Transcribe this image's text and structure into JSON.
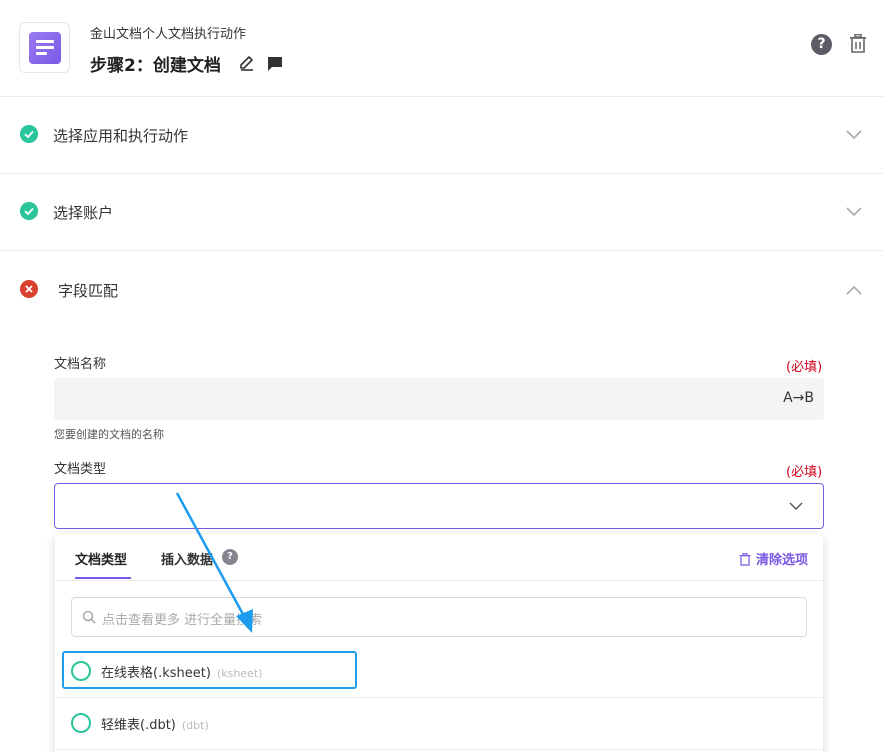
{
  "header": {
    "app_name": "金山文档个人文档执行动作",
    "step_title": "步骤2：创建文档"
  },
  "sections": [
    {
      "label": "选择应用和执行动作",
      "status": "ok"
    },
    {
      "label": "选择账户",
      "status": "ok"
    },
    {
      "label": "字段匹配",
      "status": "error"
    }
  ],
  "fields": {
    "doc_name": {
      "label": "文档名称",
      "required": "(必填)",
      "value": "",
      "toggle": "A→B",
      "help": "您要创建的文档的名称"
    },
    "doc_type": {
      "label": "文档类型",
      "required": "(必填)",
      "value": ""
    }
  },
  "dropdown": {
    "tabs": [
      "文档类型",
      "插入数据"
    ],
    "clear_label": "清除选项",
    "search_placeholder": "点击查看更多 进行全量搜索",
    "options": [
      {
        "name": "在线表格(.ksheet)",
        "sub": "(ksheet)"
      },
      {
        "name": "轻维表(.dbt)",
        "sub": "(dbt)"
      }
    ]
  },
  "colors": {
    "accent": "#7a58e6",
    "success": "#2bc59b",
    "error": "#d9412f",
    "required": "#d0021b",
    "annotation": "#1e9df0"
  }
}
